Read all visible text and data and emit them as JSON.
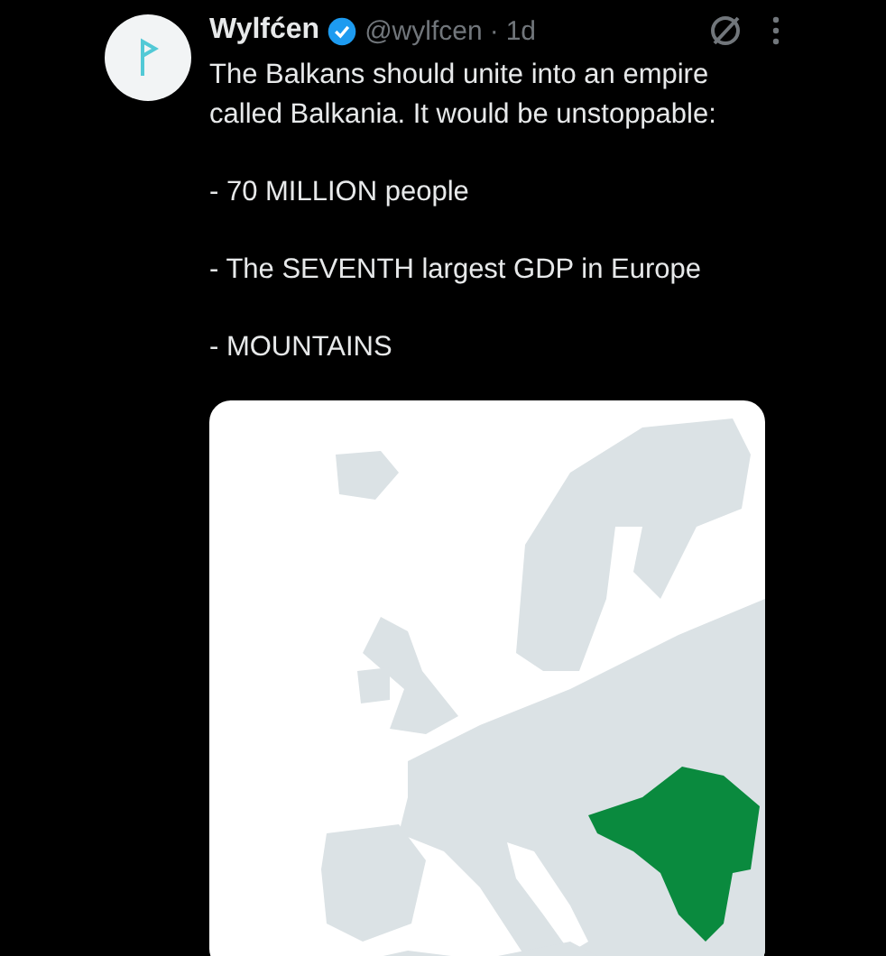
{
  "post": {
    "author": {
      "name": "Wylfćen",
      "verified": true,
      "handle": "@wylfcen",
      "separator": "·",
      "time": "1d"
    },
    "paragraphs": [
      "The Balkans should unite into an empire called Balkania. It would be unstoppable:",
      "- 70 MILLION people",
      "- The SEVENTH largest GDP in Europe",
      "- MOUNTAINS"
    ]
  }
}
